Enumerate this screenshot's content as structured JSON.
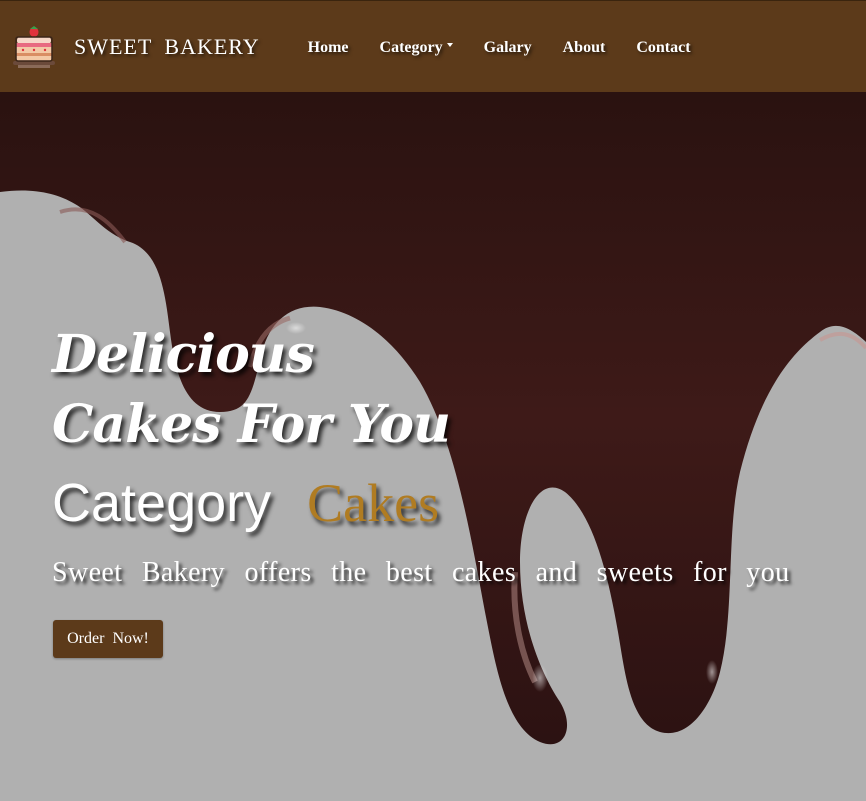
{
  "navbar": {
    "brand_text": "SWEET BAKERY",
    "logo_icon": "cake-icon",
    "links": [
      {
        "label": "Home"
      },
      {
        "label": "Category",
        "has_dropdown": true
      },
      {
        "label": "Galary"
      },
      {
        "label": "About"
      },
      {
        "label": "Contact"
      }
    ]
  },
  "hero": {
    "headline_line1": "Delicious",
    "headline_line2": "Cakes For You",
    "category_word": "Category",
    "category_highlight": "Cakes",
    "tagline": "Sweet Bakery offers the best cakes and sweets for you",
    "cta_label": "Order Now!"
  },
  "colors": {
    "navbar_bg": "#5c3a1a",
    "accent_gold": "#b07c22",
    "chocolate": "#3a1814",
    "background_gray": "#b0b0b0",
    "button_bg": "#5c3a1a"
  }
}
